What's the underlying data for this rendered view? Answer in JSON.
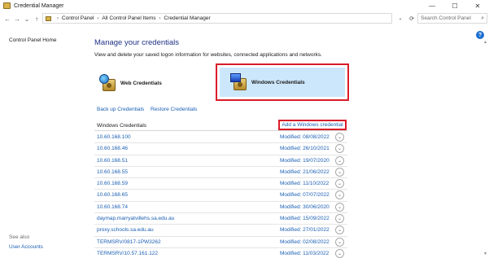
{
  "window": {
    "title": "Credential Manager",
    "controls": {
      "minimize": "—",
      "maximize": "☐",
      "close": "✕"
    }
  },
  "nav": {
    "back": "←",
    "forward": "→",
    "history_dropdown": "⌄",
    "up": "↑",
    "breadcrumbs": [
      "Control Panel",
      "All Control Panel Items",
      "Credential Manager"
    ],
    "separator": "›",
    "address_dropdown": "⌄",
    "refresh": "⟳",
    "search_placeholder": "Search Control Panel",
    "search_icon": "⌕"
  },
  "sidebar": {
    "home": "Control Panel Home",
    "see_also": "See also",
    "user_accounts": "User Accounts"
  },
  "help_icon": "?",
  "scroll": {
    "up": "▲",
    "down": "▼"
  },
  "main": {
    "heading": "Manage your credentials",
    "description": "View and delete your saved logon information for websites, connected applications and networks.",
    "tiles": {
      "web": "Web Credentials",
      "windows": "Windows Credentials"
    },
    "links": {
      "backup": "Back up Credentials",
      "restore": "Restore Credentials"
    },
    "section_title": "Windows Credentials",
    "add_credential": "Add a Windows credential",
    "expand_glyph": "⌄",
    "credentials": [
      {
        "name": "10.60.168.100",
        "modified": "Modified:  08/08/2022"
      },
      {
        "name": "10.60.168.46",
        "modified": "Modified:  26/10/2021"
      },
      {
        "name": "10.60.168.51",
        "modified": "Modified:  19/07/2020"
      },
      {
        "name": "10.60.168.55",
        "modified": "Modified:  21/06/2022"
      },
      {
        "name": "10.60.168.59",
        "modified": "Modified:  11/10/2022"
      },
      {
        "name": "10.60.168.65",
        "modified": "Modified:  07/07/2022"
      },
      {
        "name": "10.60.168.74",
        "modified": "Modified:  30/06/2020"
      },
      {
        "name": "daymap.marryatvillehs.sa.edu.au",
        "modified": "Modified:  15/09/2022"
      },
      {
        "name": "proxy.schools.sa.edu.au",
        "modified": "Modified:  27/01/2022"
      },
      {
        "name": "TERMSRV/0817-1PW3262",
        "modified": "Modified:  02/08/2022"
      },
      {
        "name": "TERMSRV/10.57.161.122",
        "modified": "Modified:  11/03/2022"
      }
    ]
  }
}
